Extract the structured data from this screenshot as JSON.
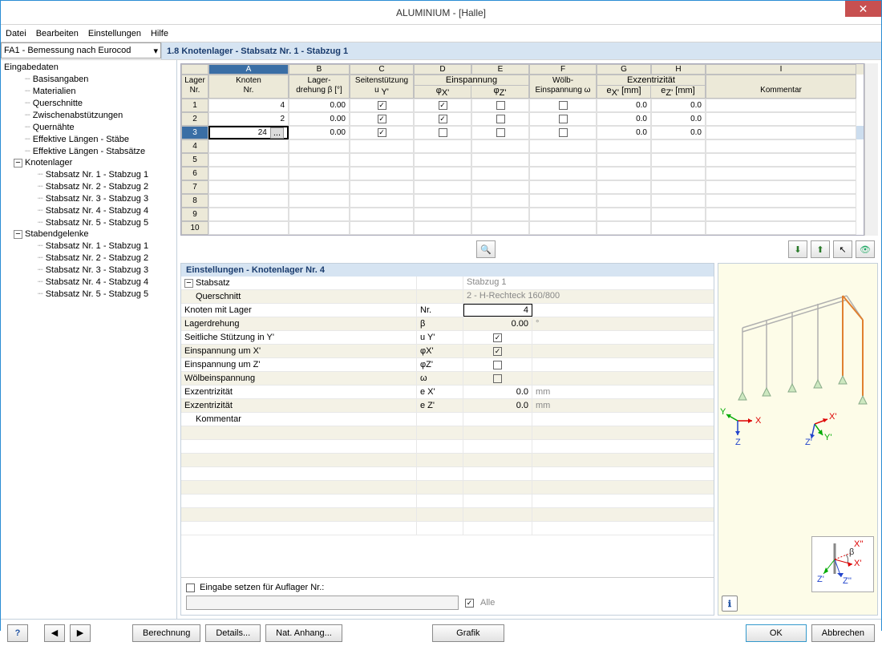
{
  "title": "ALUMINIUM - [Halle]",
  "menubar": [
    "Datei",
    "Bearbeiten",
    "Einstellungen",
    "Hilfe"
  ],
  "fa_select": "FA1 - Bemessung nach Eurocod",
  "panel_heading": "1.8 Knotenlager - Stabsatz Nr. 1 - Stabzug 1",
  "tree": {
    "root": "Eingabedaten",
    "items": [
      "Basisangaben",
      "Materialien",
      "Querschnitte",
      "Zwischenabstützungen",
      "Quernähte",
      "Effektive Längen - Stäbe",
      "Effektive Längen - Stabsätze"
    ],
    "knotenlager": {
      "label": "Knotenlager",
      "children": [
        "Stabsatz Nr. 1 - Stabzug 1",
        "Stabsatz Nr. 2 - Stabzug 2",
        "Stabsatz Nr. 3 - Stabzug 3",
        "Stabsatz Nr. 4 - Stabzug 4",
        "Stabsatz Nr. 5 - Stabzug 5"
      ]
    },
    "stabend": {
      "label": "Stabendgelenke",
      "children": [
        "Stabsatz Nr. 1 - Stabzug 1",
        "Stabsatz Nr. 2 - Stabzug 2",
        "Stabsatz Nr. 3 - Stabzug 3",
        "Stabsatz Nr. 4 - Stabzug 4",
        "Stabsatz Nr. 5 - Stabzug 5"
      ]
    }
  },
  "grid": {
    "letters": [
      "A",
      "B",
      "C",
      "D",
      "E",
      "F",
      "G",
      "H",
      "I"
    ],
    "group_headers": {
      "lager": "Lager\nNr.",
      "knoten": "Knoten\nNr.",
      "lagerdreh": "Lager-\ndrehung β [°]",
      "seiten": "Seitenstützung\nu Y'",
      "einsp": "Einspannung",
      "einsp_x": "φX'",
      "einsp_z": "φZ'",
      "woelb": "Wölb-\nEinspannung ω",
      "exz": "Exzentrizität",
      "ex": "e X' [mm]",
      "ez": "e Z' [mm]",
      "komm": "Kommentar"
    },
    "rows": [
      {
        "n": "1",
        "knoten": "4",
        "dreh": "0.00",
        "uy": true,
        "px": true,
        "pz": false,
        "w": false,
        "ex": "0.0",
        "ez": "0.0"
      },
      {
        "n": "2",
        "knoten": "2",
        "dreh": "0.00",
        "uy": true,
        "px": true,
        "pz": false,
        "w": false,
        "ex": "0.0",
        "ez": "0.0"
      },
      {
        "n": "3",
        "knoten": "24",
        "dreh": "0.00",
        "uy": true,
        "px": false,
        "pz": false,
        "w": false,
        "ex": "0.0",
        "ez": "0.0",
        "sel": true
      },
      {
        "n": "4"
      },
      {
        "n": "5"
      },
      {
        "n": "6"
      },
      {
        "n": "7"
      },
      {
        "n": "8"
      },
      {
        "n": "9"
      },
      {
        "n": "10"
      }
    ]
  },
  "detail": {
    "title": "Einstellungen - Knotenlager Nr. 4",
    "rows": [
      {
        "label": "Stabsatz",
        "toggle": true,
        "val": "Stabzug 1",
        "gray": true,
        "span": true
      },
      {
        "label": "Querschnitt",
        "indent": true,
        "val": "2 - H-Rechteck 160/800",
        "gray": true,
        "span": true
      },
      {
        "label": "Knoten mit Lager",
        "sym": "Nr.",
        "val": "4",
        "active": true
      },
      {
        "label": "Lagerdrehung",
        "sym": "β",
        "val": "0.00",
        "unit": "°"
      },
      {
        "label": "Seitliche Stützung in Y'",
        "sym": "u Y'",
        "chk": true
      },
      {
        "label": "Einspannung um X'",
        "sym": "φX'",
        "chk": true
      },
      {
        "label": "Einspannung um Z'",
        "sym": "φZ'",
        "chk": false
      },
      {
        "label": "Wölbeinspannung",
        "sym": "ω",
        "chk": false
      },
      {
        "label": "Exzentrizität",
        "sym": "e X'",
        "val": "0.0",
        "unit": "mm"
      },
      {
        "label": "Exzentrizität",
        "sym": "e Z'",
        "val": "0.0",
        "unit": "mm"
      },
      {
        "label": "Kommentar",
        "indent": true
      }
    ],
    "footer_chk": "Eingabe setzen für Auflager Nr.:",
    "footer_alle": "Alle"
  },
  "buttons": {
    "berechnung": "Berechnung",
    "details": "Details...",
    "nat": "Nat. Anhang...",
    "grafik": "Grafik",
    "ok": "OK",
    "abbr": "Abbrechen"
  },
  "axis_labels": {
    "x": "X",
    "y": "Y",
    "z": "Z",
    "xp": "X'",
    "yp": "Y'",
    "zp": "Z'",
    "xpp": "X''",
    "zpp": "Z''",
    "beta": "β"
  }
}
